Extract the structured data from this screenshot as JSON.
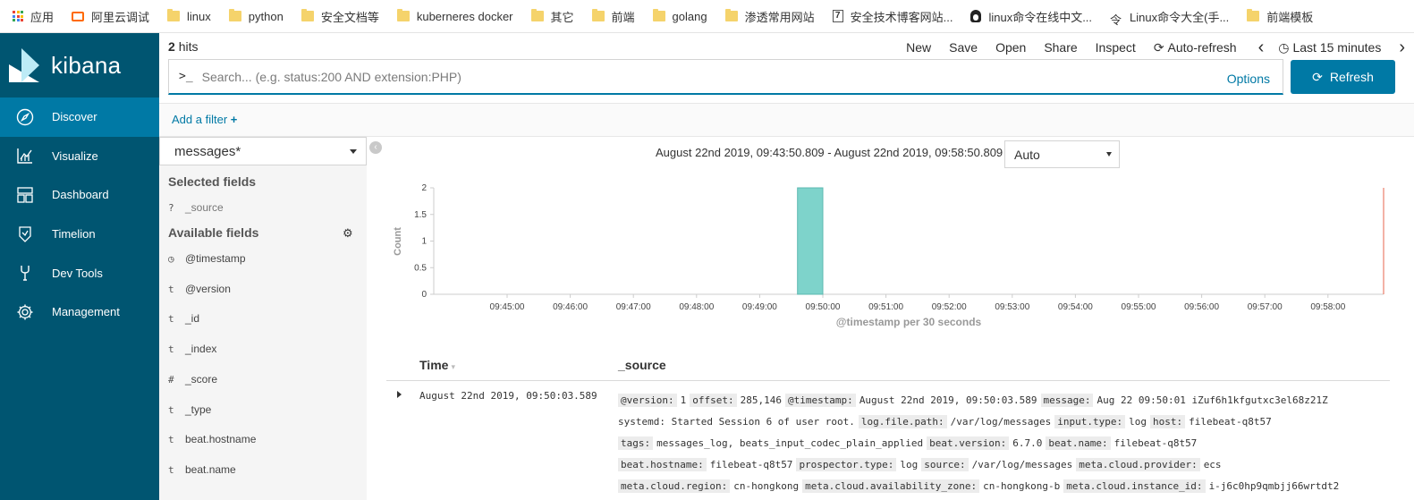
{
  "bookmarks": [
    {
      "label": "应用",
      "icon": "apps-grid-icon"
    },
    {
      "label": "阿里云调试",
      "icon": "aliyun-icon"
    },
    {
      "label": "linux",
      "icon": "folder-icon"
    },
    {
      "label": "python",
      "icon": "folder-icon"
    },
    {
      "label": "安全文档等",
      "icon": "folder-icon"
    },
    {
      "label": "kuberneres docker",
      "icon": "folder-icon"
    },
    {
      "label": "其它",
      "icon": "folder-icon"
    },
    {
      "label": "前端",
      "icon": "folder-icon"
    },
    {
      "label": "golang",
      "icon": "folder-icon"
    },
    {
      "label": "渗透常用网站",
      "icon": "folder-icon"
    },
    {
      "label": "安全技术博客网站...",
      "icon": "page-icon"
    },
    {
      "label": "linux命令在线中文...",
      "icon": "tux-icon"
    },
    {
      "label": "Linux命令大全(手...",
      "icon": "command-icon"
    },
    {
      "label": "前端模板",
      "icon": "folder-icon"
    }
  ],
  "brand": {
    "name": "kibana",
    "accent": "#005571",
    "active": "#0079a5"
  },
  "nav": [
    {
      "label": "Discover",
      "icon": "compass-icon",
      "active": true
    },
    {
      "label": "Visualize",
      "icon": "visualize-icon",
      "active": false
    },
    {
      "label": "Dashboard",
      "icon": "dashboard-icon",
      "active": false
    },
    {
      "label": "Timelion",
      "icon": "timelion-icon",
      "active": false
    },
    {
      "label": "Dev Tools",
      "icon": "wrench-icon",
      "active": false
    },
    {
      "label": "Management",
      "icon": "gear-icon",
      "active": false
    }
  ],
  "hits": {
    "count": "2",
    "label": "hits"
  },
  "topmenu": {
    "new": "New",
    "save": "Save",
    "open": "Open",
    "share": "Share",
    "inspect": "Inspect",
    "autorefresh": "Auto-refresh",
    "prev": "‹",
    "timepicker": "Last 15 minutes",
    "next": "›"
  },
  "search": {
    "prompt": ">_",
    "placeholder": "Search... (e.g. status:200 AND extension:PHP)",
    "options": "Options",
    "refresh": "Refresh"
  },
  "filter": {
    "add": "Add a filter"
  },
  "fields": {
    "index": "messages*",
    "selected_title": "Selected fields",
    "selected": [
      {
        "type": "?",
        "name": "_source"
      }
    ],
    "available_title": "Available fields",
    "available": [
      {
        "type": "◷",
        "name": "@timestamp"
      },
      {
        "type": "t",
        "name": "@version"
      },
      {
        "type": "t",
        "name": "_id"
      },
      {
        "type": "t",
        "name": "_index"
      },
      {
        "type": "#",
        "name": "_score"
      },
      {
        "type": "t",
        "name": "_type"
      },
      {
        "type": "t",
        "name": "beat.hostname"
      },
      {
        "type": "t",
        "name": "beat.name"
      }
    ]
  },
  "timerange": "August 22nd 2019, 09:43:50.809 - August 22nd 2019, 09:58:50.809 —",
  "interval": "Auto",
  "chart_data": {
    "type": "bar",
    "ylabel": "Count",
    "xlabel": "@timestamp per 30 seconds",
    "yticks": [
      "0",
      "0.5",
      "1",
      "1.5",
      "2"
    ],
    "ylim": [
      0,
      2
    ],
    "xticks": [
      "09:45:00",
      "09:46:00",
      "09:47:00",
      "09:48:00",
      "09:49:00",
      "09:50:00",
      "09:51:00",
      "09:52:00",
      "09:53:00",
      "09:54:00",
      "09:55:00",
      "09:56:00",
      "09:57:00",
      "09:58:00"
    ],
    "bars": [
      {
        "x": "09:50:00",
        "value": 2
      }
    ],
    "bar_color": "#7ed3cb"
  },
  "table": {
    "col_time": "Time",
    "col_source": "_source",
    "row": {
      "time": "August 22nd 2019, 09:50:03.589",
      "source_lines": [
        [
          [
            "@version:",
            "1"
          ],
          [
            "offset:",
            "285,146"
          ],
          [
            "@timestamp:",
            "August 22nd 2019, 09:50:03.589"
          ],
          [
            "message:",
            "Aug 22 09:50:01 iZuf6h1kfgutxc3el68z21Z"
          ]
        ],
        [
          [
            "",
            "systemd: Started Session 6 of user root."
          ],
          [
            "log.file.path:",
            "/var/log/messages"
          ],
          [
            "input.type:",
            "log"
          ],
          [
            "host:",
            "filebeat-q8t57"
          ]
        ],
        [
          [
            "tags:",
            "messages_log, beats_input_codec_plain_applied"
          ],
          [
            "beat.version:",
            "6.7.0"
          ],
          [
            "beat.name:",
            "filebeat-q8t57"
          ]
        ],
        [
          [
            "beat.hostname:",
            "filebeat-q8t57"
          ],
          [
            "prospector.type:",
            "log"
          ],
          [
            "source:",
            "/var/log/messages"
          ],
          [
            "meta.cloud.provider:",
            "ecs"
          ]
        ],
        [
          [
            "meta.cloud.region:",
            "cn-hongkong"
          ],
          [
            "meta.cloud.availability_zone:",
            "cn-hongkong-b"
          ],
          [
            "meta.cloud.instance_id:",
            "i-j6c0hp9qmbjj66wrtdt2"
          ]
        ]
      ]
    }
  }
}
